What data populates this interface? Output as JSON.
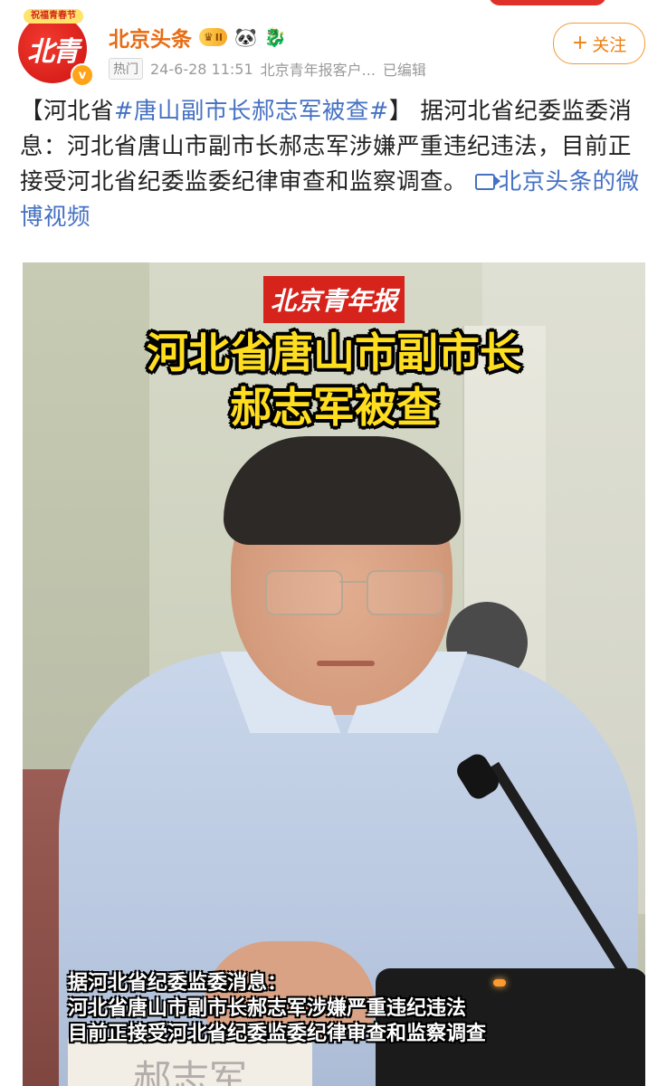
{
  "header": {
    "avatar_banner": "祝福青春节",
    "avatar_logo": "北青",
    "account_name": "北京头条",
    "vip_label": "II",
    "follow_label": "关注",
    "meta": {
      "hot_tag": "热门",
      "timestamp": "24-6-28 11:51",
      "source": "北京青年报客户...",
      "edited": "已编辑"
    }
  },
  "post": {
    "prefix": "【河北省",
    "hashtag": "#唐山副市长郝志军被查#",
    "suffix_bracket": "】",
    "body": "据河北省纪委监委消息：河北省唐山市副市长郝志军涉嫌严重违纪违法，目前正接受河北省纪委监委纪律审查和监察调查。",
    "video_link": "北京头条的微博视频"
  },
  "video": {
    "logo_text": "北京青年报",
    "headline_line1": "河北省唐山市副市长",
    "headline_line2": "郝志军被查",
    "subtitle_line1": "据河北省纪委监委消息：",
    "subtitle_line2": "河北省唐山市副市长郝志军涉嫌严重违纪违法",
    "subtitle_line3": "目前正接受河北省纪委监委纪律审查和监察调查",
    "nameplate_text": "郝志军"
  },
  "colors": {
    "account_name": "#e86b12",
    "link": "#4571c2",
    "headline": "#ffde1f",
    "logo_red": "#d6231c"
  }
}
